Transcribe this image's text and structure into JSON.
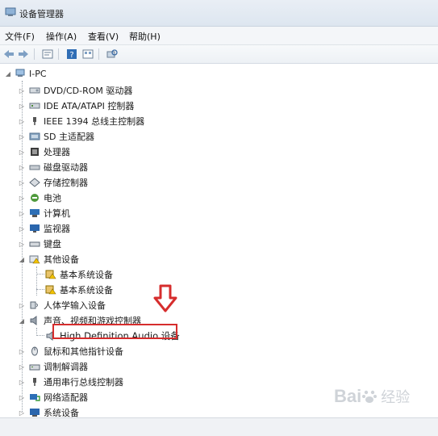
{
  "window": {
    "title": "设备管理器"
  },
  "menu": [
    "文件(F)",
    "操作(A)",
    "查看(V)",
    "帮助(H)"
  ],
  "tree": {
    "root": "I-PC",
    "items": [
      {
        "label": "DVD/CD-ROM 驱动器",
        "icon": "dvd-drive-icon"
      },
      {
        "label": "IDE ATA/ATAPI 控制器",
        "icon": "ide-controller-icon"
      },
      {
        "label": "IEEE 1394 总线主控制器",
        "icon": "ieee1394-icon"
      },
      {
        "label": "SD 主适配器",
        "icon": "sd-adapter-icon"
      },
      {
        "label": "处理器",
        "icon": "processor-icon"
      },
      {
        "label": "磁盘驱动器",
        "icon": "disk-drive-icon"
      },
      {
        "label": "存储控制器",
        "icon": "storage-controller-icon"
      },
      {
        "label": "电池",
        "icon": "battery-icon"
      },
      {
        "label": "计算机",
        "icon": "computer-icon"
      },
      {
        "label": "监视器",
        "icon": "monitor-icon"
      },
      {
        "label": "键盘",
        "icon": "keyboard-icon"
      },
      {
        "label": "其他设备",
        "icon": "other-devices-icon",
        "expanded": true,
        "children": [
          {
            "label": "基本系统设备",
            "icon": "warning-device-icon"
          },
          {
            "label": "基本系统设备",
            "icon": "warning-device-icon"
          }
        ]
      },
      {
        "label": "人体学输入设备",
        "icon": "hid-icon"
      },
      {
        "label": "声音、视频和游戏控制器",
        "icon": "speaker-icon",
        "expanded": true,
        "children": [
          {
            "label": "High Definition Audio 设备",
            "icon": "audio-device-icon"
          }
        ]
      },
      {
        "label": "鼠标和其他指针设备",
        "icon": "mouse-icon"
      },
      {
        "label": "调制解调器",
        "icon": "modem-icon"
      },
      {
        "label": "通用串行总线控制器",
        "icon": "usb-icon"
      },
      {
        "label": "网络适配器",
        "icon": "network-adapter-icon"
      },
      {
        "label": "系统设备",
        "icon": "system-device-icon"
      }
    ]
  },
  "watermark": {
    "brand": "Bai",
    "suffix": "经验"
  },
  "colors": {
    "highlight": "#d62d2d",
    "arrow": "#d62d2d"
  }
}
